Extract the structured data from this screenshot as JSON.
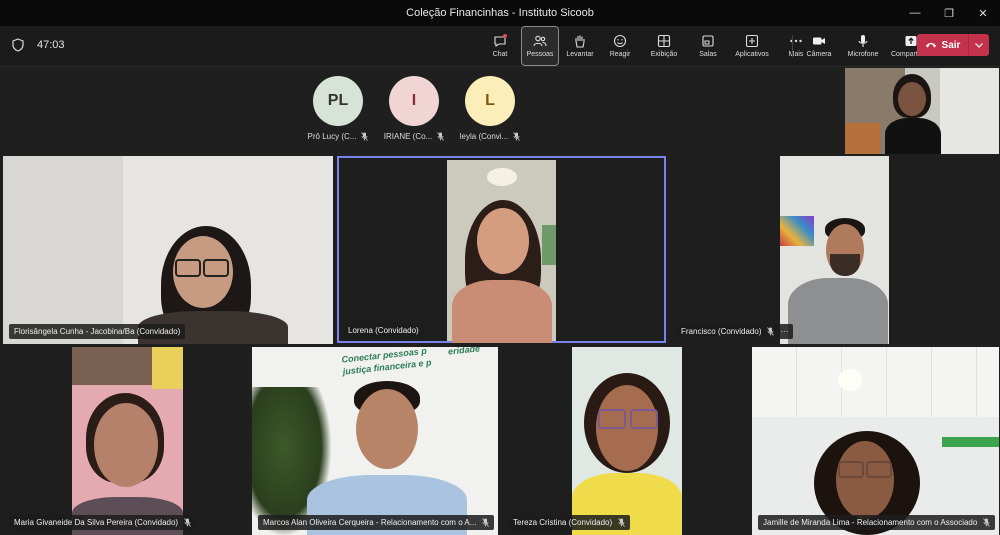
{
  "window": {
    "title": "Coleção Financinhas - Instituto Sicoob",
    "controls": [
      "—",
      "❐",
      "✕"
    ]
  },
  "toolbar": {
    "timer": "47:03",
    "buttons": [
      {
        "label": "Chat",
        "icon": "chat-icon"
      },
      {
        "label": "Pessoas",
        "icon": "people-icon",
        "active": true
      },
      {
        "label": "Levantar",
        "icon": "raise-hand-icon"
      },
      {
        "label": "Reagir",
        "icon": "react-icon"
      },
      {
        "label": "Exibição",
        "icon": "view-icon"
      },
      {
        "label": "Salas",
        "icon": "rooms-icon"
      },
      {
        "label": "Aplicativos",
        "icon": "apps-icon"
      },
      {
        "label": "Mais",
        "icon": "more-icon"
      }
    ],
    "device_buttons": [
      {
        "label": "Câmera",
        "icon": "camera-icon"
      },
      {
        "label": "Microfone",
        "icon": "microphone-icon"
      },
      {
        "label": "Compartilhar",
        "icon": "share-icon"
      }
    ],
    "leave_label": "Sair",
    "leave_color": "#c4314b"
  },
  "avatars": [
    {
      "initials": "PL",
      "name": "Prô Lucy (C...",
      "color": "#d6e3d6"
    },
    {
      "initials": "I",
      "name": "IRIANE (Co...",
      "color": "#f1d5d5"
    },
    {
      "initials": "L",
      "name": "leyla (Convi...",
      "color": "#fbeeb8"
    }
  ],
  "tiles": [
    {
      "name": "Florisângela Cunha - Jacobina/Ba (Convidado)"
    },
    {
      "name": "Lorena (Convidado)"
    },
    {
      "name": "Francisco (Convidado)",
      "more": "···"
    },
    {
      "name": "Maria Givaneide Da Silva Pereira (Convidado)"
    },
    {
      "name": "Marcos Alan Oliveira Cerqueira - Relacionamento com o A..."
    },
    {
      "name": "Tereza Cristina (Convidado)"
    },
    {
      "name": "Jamille de Miranda Lima - Relacionamento com o Associado"
    }
  ],
  "wall_text": [
    "Conectar pessoas p",
    "justiça financeira e p",
    "eridade"
  ],
  "colors": {
    "active_speaker_border": "#7b83eb"
  }
}
